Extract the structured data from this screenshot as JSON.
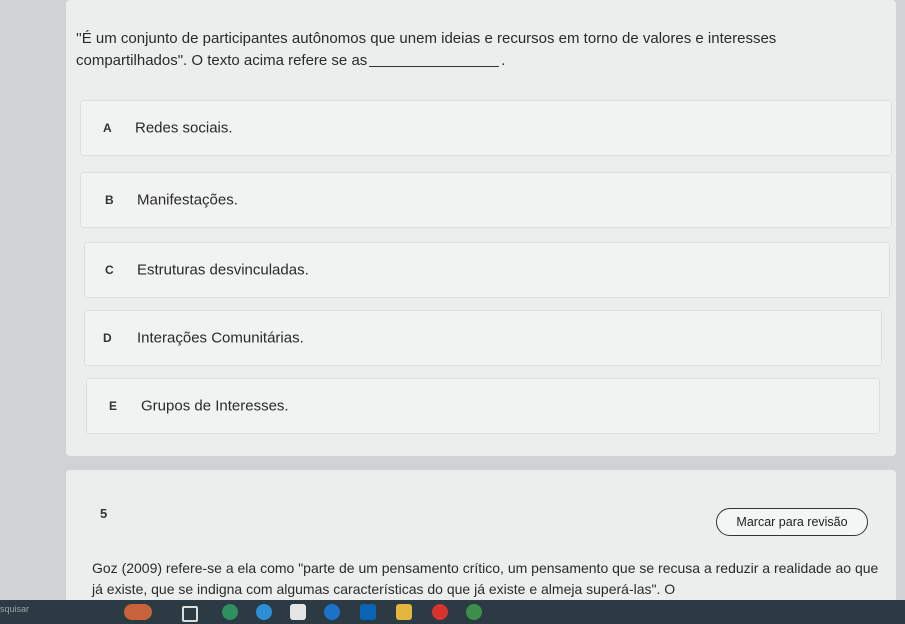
{
  "question4": {
    "text_before": "''É um conjunto de participantes autônomos que unem ideias e recursos em torno de valores e interesses compartilhados\". O texto acima refere se as",
    "text_after": ".",
    "options": [
      {
        "letter": "A",
        "text": "Redes sociais."
      },
      {
        "letter": "B",
        "text": "Manifestações."
      },
      {
        "letter": "C",
        "text": "Estruturas desvinculadas."
      },
      {
        "letter": "D",
        "text": "Interações Comunitárias."
      },
      {
        "letter": "E",
        "text": "Grupos de Interesses."
      }
    ]
  },
  "question5": {
    "number": "5",
    "review_label": "Marcar para revisão",
    "text": "Goz (2009) refere-se a ela como \"parte de um pensamento crítico, um pensamento que se recusa a reduzir a realidade ao que já existe, que se indigna com algumas características do que já existe e almeja superá-las\". O"
  },
  "taskbar": {
    "search_label": "squisar",
    "icons": [
      "weather-icon",
      "task-view-icon",
      "media-icon",
      "edge-icon",
      "calendar-icon",
      "chrome-icon",
      "outlook-icon",
      "files-icon",
      "opera-icon",
      "app-icon"
    ]
  },
  "colors": {
    "background": "#cfd3d6",
    "card": "#eceeee",
    "taskbar": "#2b3a43"
  }
}
